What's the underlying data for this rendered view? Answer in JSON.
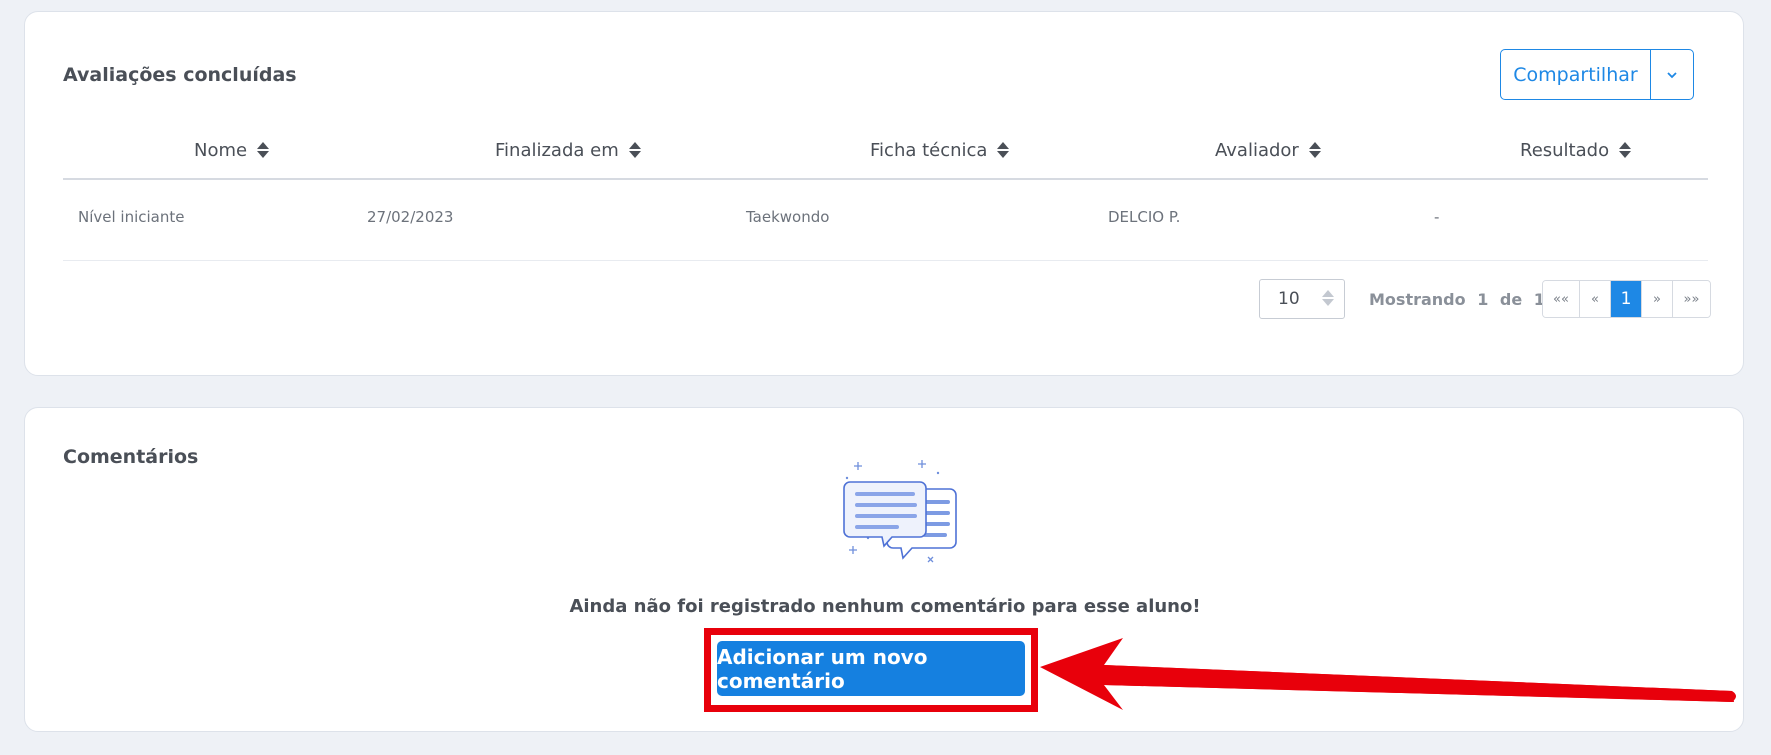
{
  "evaluations": {
    "title": "Avaliações concluídas",
    "share_label": "Compartilhar",
    "columns": [
      "Nome",
      "Finalizada em",
      "Ficha técnica",
      "Avaliador",
      "Resultado"
    ],
    "rows": [
      {
        "nome": "Nível iniciante",
        "finalizada": "27/02/2023",
        "ficha": "Taekwondo",
        "avaliador": "DELCIO P.",
        "resultado": "-"
      }
    ],
    "per_page": "10",
    "showing": {
      "label": "Mostrando",
      "current": "1",
      "of": "de",
      "total": "1"
    },
    "pager": [
      "««",
      "«",
      "1",
      "»",
      "»»"
    ]
  },
  "comments": {
    "title": "Comentários",
    "empty_message": "Ainda não foi registrado nenhum comentário para esse aluno!",
    "add_button": "Adicionar um novo comentário"
  },
  "colors": {
    "accent": "#1e88e5",
    "annotation": "#e8000b"
  }
}
